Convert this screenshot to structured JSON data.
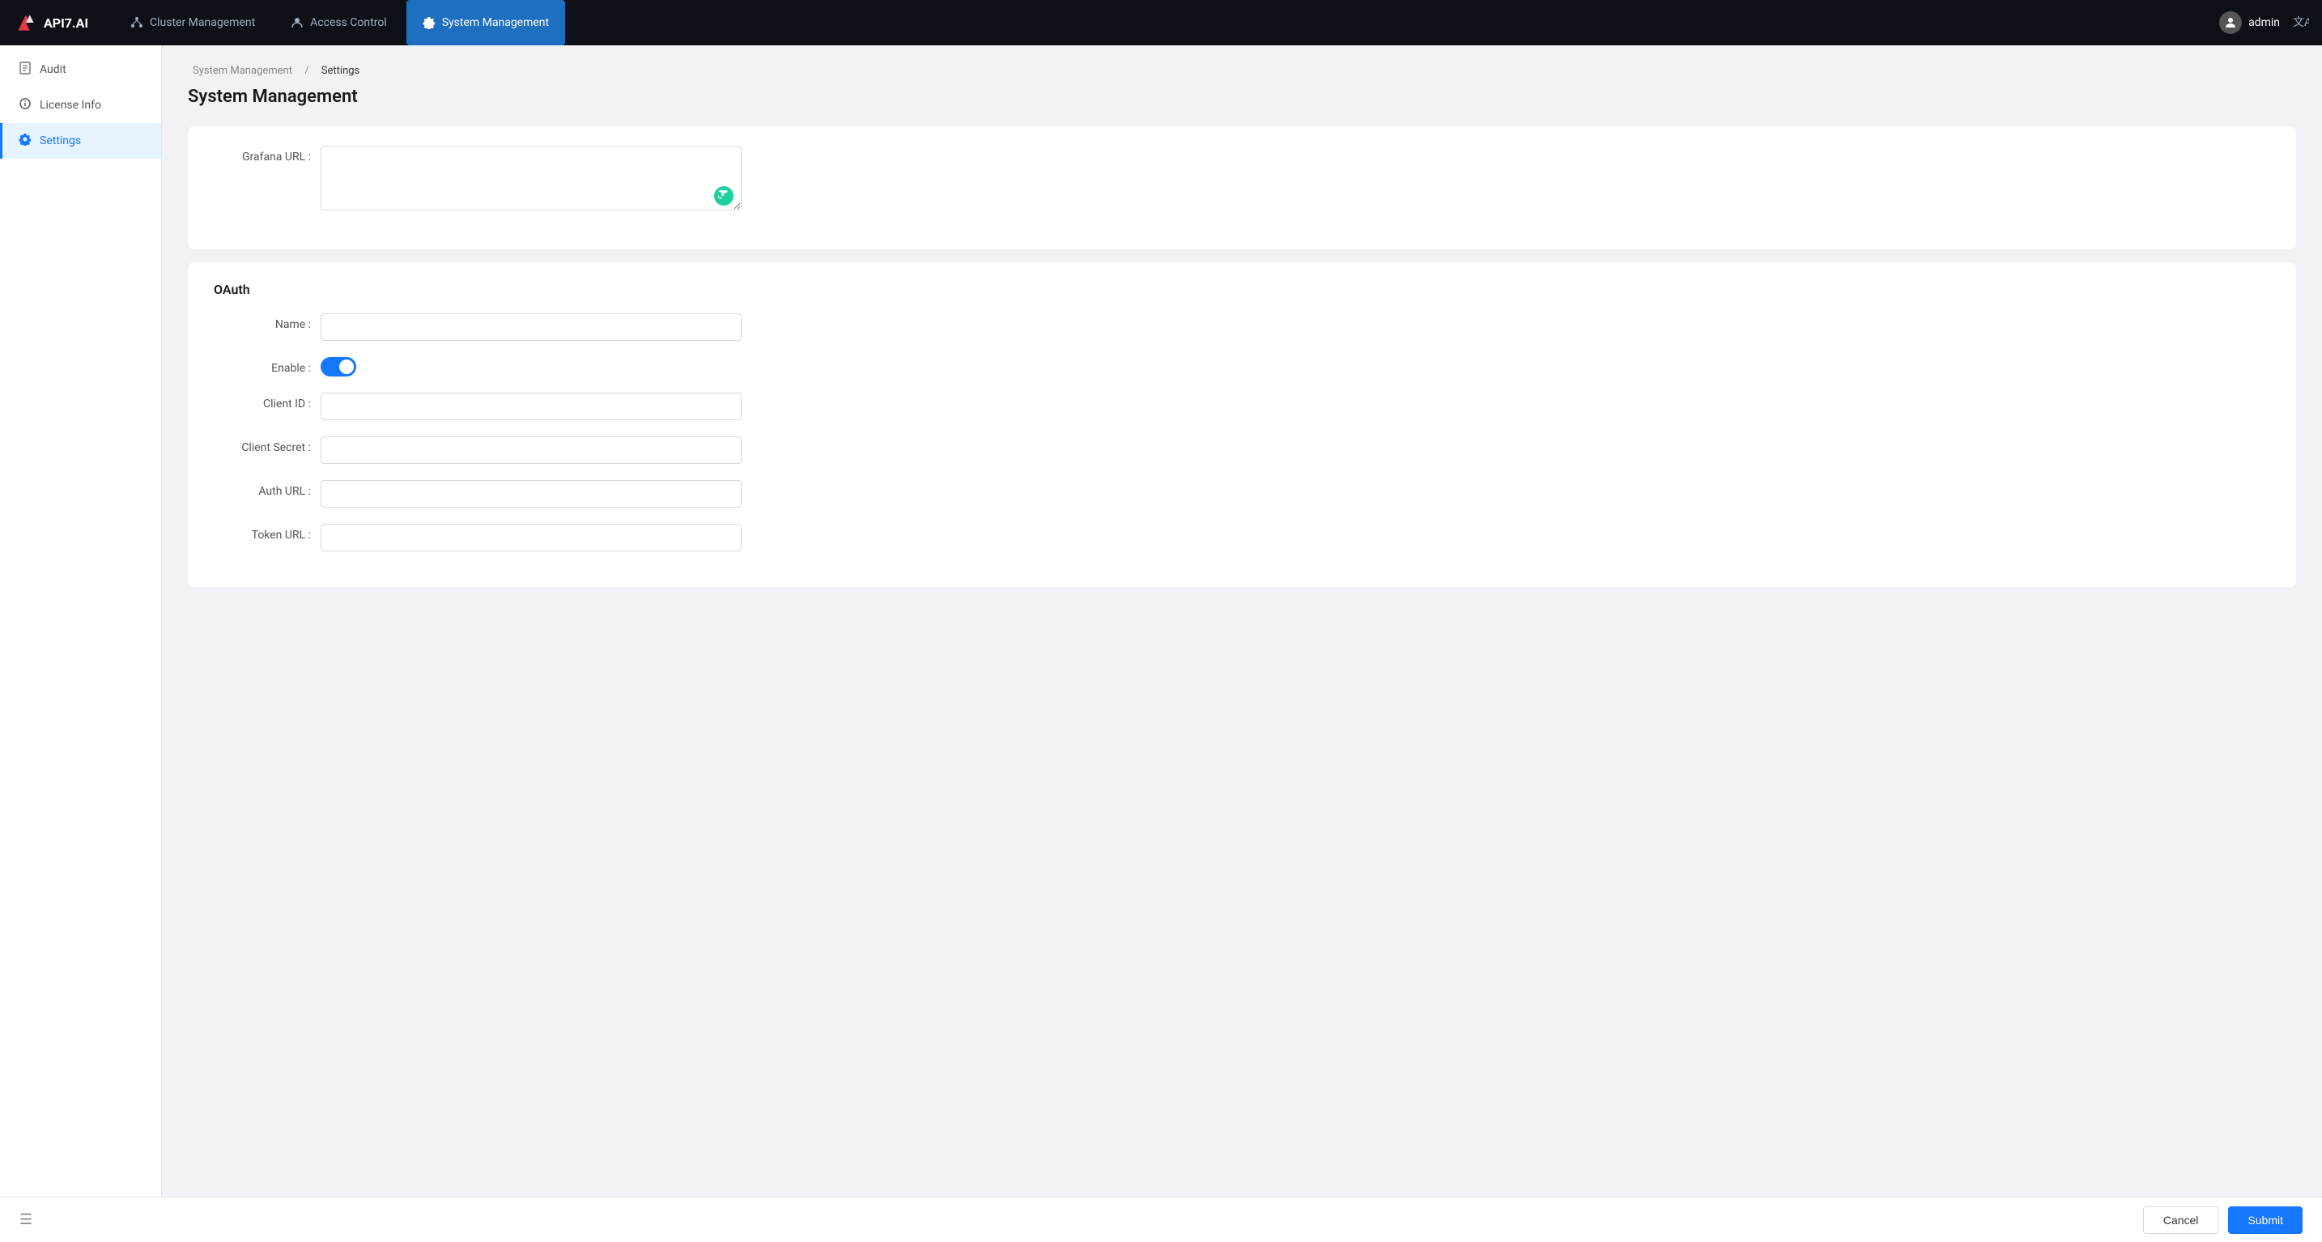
{
  "app": {
    "logo_text": "API7.AI"
  },
  "nav": {
    "items": [
      {
        "id": "cluster",
        "label": "Cluster Management",
        "icon": "cluster",
        "active": false
      },
      {
        "id": "access",
        "label": "Access Control",
        "icon": "user",
        "active": false
      },
      {
        "id": "system",
        "label": "System Management",
        "icon": "gear",
        "active": true
      }
    ],
    "user_label": "admin",
    "translate_icon": "A"
  },
  "sidebar": {
    "items": [
      {
        "id": "audit",
        "label": "Audit",
        "icon": "audit",
        "active": false
      },
      {
        "id": "license",
        "label": "License Info",
        "icon": "info",
        "active": false
      },
      {
        "id": "settings",
        "label": "Settings",
        "icon": "gear",
        "active": true
      }
    ]
  },
  "breadcrumb": {
    "parent": "System Management",
    "separator": "/",
    "current": "Settings"
  },
  "page_title": "System Management",
  "grafana_section": {
    "label": "Grafana URL :",
    "placeholder": ""
  },
  "oauth_section": {
    "title": "OAuth",
    "name_label": "Name :",
    "enable_label": "Enable :",
    "enabled": true,
    "client_id_label": "Client ID :",
    "client_secret_label": "Client Secret :",
    "auth_url_label": "Auth URL :",
    "token_url_label": "Token URL :"
  },
  "footer": {
    "menu_icon": "☰",
    "cancel_label": "Cancel",
    "submit_label": "Submit"
  }
}
